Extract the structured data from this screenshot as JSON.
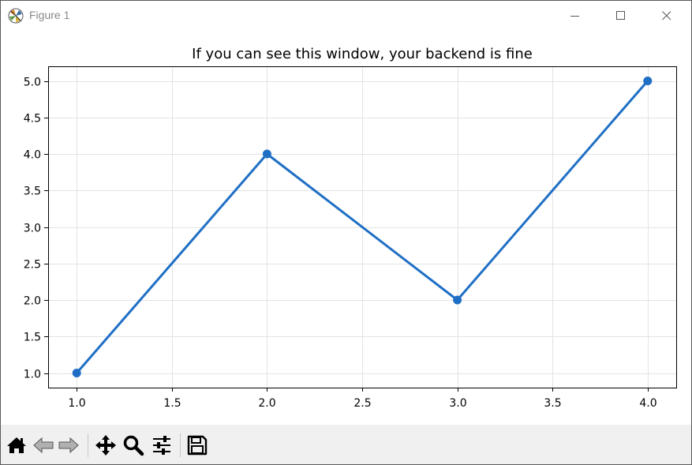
{
  "window": {
    "title": "Figure 1"
  },
  "titlebar_buttons": [
    "minimize-icon",
    "maximize-icon",
    "close-icon"
  ],
  "toolbar": {
    "buttons": [
      "home-icon",
      "back-icon",
      "forward-icon",
      "pan-icon",
      "zoom-icon",
      "configure-subplots-icon",
      "save-icon"
    ]
  },
  "colors": {
    "line": "#1f6fc5",
    "grid": "#e3e3e3",
    "toolbar_bg": "#f0f0f0"
  },
  "chart_data": {
    "type": "line",
    "title": "If you can see this window, your backend is fine",
    "xlabel": "",
    "ylabel": "",
    "x": [
      1.0,
      2.0,
      3.0,
      4.0
    ],
    "series": [
      {
        "values": [
          1.0,
          4.0,
          2.0,
          5.0
        ],
        "marker": "circle"
      }
    ],
    "xticks": [
      "1.0",
      "1.5",
      "2.0",
      "2.5",
      "3.0",
      "3.5",
      "4.0"
    ],
    "yticks": [
      "1.0",
      "1.5",
      "2.0",
      "2.5",
      "3.0",
      "3.5",
      "4.0",
      "4.5",
      "5.0"
    ],
    "xlim": [
      0.85,
      4.15
    ],
    "ylim": [
      0.8,
      5.2
    ],
    "grid": true
  }
}
